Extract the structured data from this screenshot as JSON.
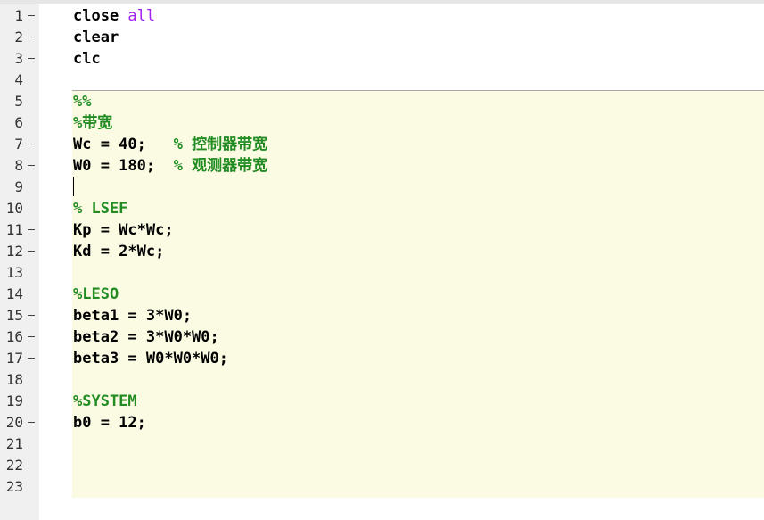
{
  "editor": {
    "lines": [
      {
        "num": "1",
        "dash": true,
        "segments": [
          {
            "t": "close ",
            "c": "code"
          },
          {
            "t": "all",
            "c": "keyword"
          }
        ]
      },
      {
        "num": "2",
        "dash": true,
        "segments": [
          {
            "t": "clear",
            "c": "code"
          }
        ]
      },
      {
        "num": "3",
        "dash": true,
        "segments": [
          {
            "t": "clc",
            "c": "code"
          }
        ]
      },
      {
        "num": "4",
        "dash": false,
        "segments": []
      },
      {
        "num": "5",
        "dash": false,
        "segments": [
          {
            "t": "%%",
            "c": "comment"
          }
        ]
      },
      {
        "num": "6",
        "dash": false,
        "segments": [
          {
            "t": "%带宽",
            "c": "comment"
          }
        ]
      },
      {
        "num": "7",
        "dash": true,
        "segments": [
          {
            "t": "Wc = 40;   ",
            "c": "code"
          },
          {
            "t": "% 控制器带宽",
            "c": "comment"
          }
        ]
      },
      {
        "num": "8",
        "dash": true,
        "segments": [
          {
            "t": "W0 = 180;  ",
            "c": "code"
          },
          {
            "t": "% 观测器带宽",
            "c": "comment"
          }
        ]
      },
      {
        "num": "9",
        "dash": false,
        "segments": []
      },
      {
        "num": "10",
        "dash": false,
        "segments": [
          {
            "t": "% LSEF",
            "c": "comment"
          }
        ]
      },
      {
        "num": "11",
        "dash": true,
        "segments": [
          {
            "t": "Kp = Wc*Wc;",
            "c": "code"
          }
        ]
      },
      {
        "num": "12",
        "dash": true,
        "segments": [
          {
            "t": "Kd = 2*Wc;",
            "c": "code"
          }
        ]
      },
      {
        "num": "13",
        "dash": false,
        "segments": []
      },
      {
        "num": "14",
        "dash": false,
        "segments": [
          {
            "t": "%LESO",
            "c": "comment"
          }
        ]
      },
      {
        "num": "15",
        "dash": true,
        "segments": [
          {
            "t": "beta1 = 3*W0;",
            "c": "code"
          }
        ]
      },
      {
        "num": "16",
        "dash": true,
        "segments": [
          {
            "t": "beta2 = 3*W0*W0;",
            "c": "code"
          }
        ]
      },
      {
        "num": "17",
        "dash": true,
        "segments": [
          {
            "t": "beta3 = W0*W0*W0;",
            "c": "code"
          }
        ]
      },
      {
        "num": "18",
        "dash": false,
        "segments": []
      },
      {
        "num": "19",
        "dash": false,
        "segments": [
          {
            "t": "%SYSTEM",
            "c": "comment"
          }
        ]
      },
      {
        "num": "20",
        "dash": true,
        "segments": [
          {
            "t": "b0 = 12;",
            "c": "code"
          }
        ]
      },
      {
        "num": "21",
        "dash": false,
        "segments": []
      },
      {
        "num": "22",
        "dash": false,
        "segments": []
      },
      {
        "num": "23",
        "dash": false,
        "segments": []
      }
    ]
  },
  "colors": {
    "code": "#000000",
    "keyword": "#a020f0",
    "comment": "#228b22",
    "cell_background": "#fbfbe3",
    "gutter_background": "#f0f0f0"
  }
}
